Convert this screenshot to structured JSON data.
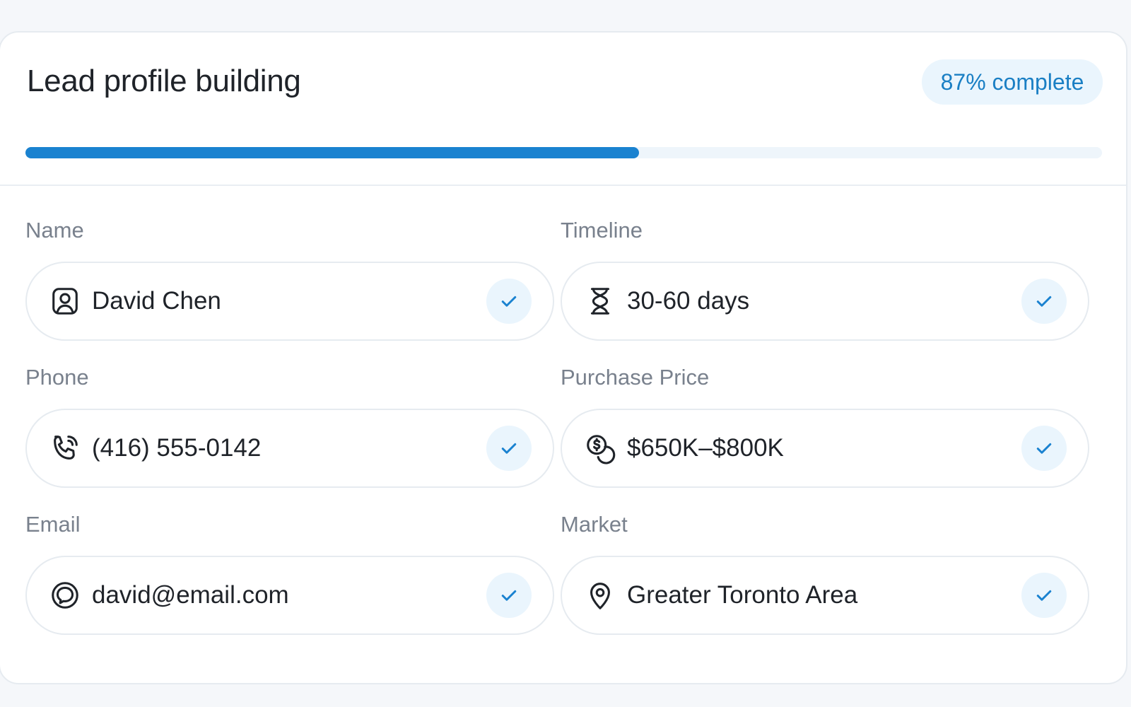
{
  "card": {
    "title": "Lead profile building",
    "badge": "87% complete",
    "progress": 0.57
  },
  "fields": {
    "name": {
      "label": "Name",
      "value": "David Chen",
      "icon": "user-icon"
    },
    "timeline": {
      "label": "Timeline",
      "value": "30-60 days",
      "icon": "hourglass-icon"
    },
    "phone": {
      "label": "Phone",
      "value": "(416) 555-0142",
      "icon": "phone-icon"
    },
    "purchase_price": {
      "label": "Purchase Price",
      "value": "$650K–$800K",
      "icon": "coins-icon"
    },
    "email": {
      "label": "Email",
      "value": "david@email.com",
      "icon": "email-icon"
    },
    "market": {
      "label": "Market",
      "value": "Greater Toronto Area",
      "icon": "map-pin-icon"
    }
  },
  "colors": {
    "accent": "#1a82d0",
    "badge_bg": "#eaf5fd",
    "check": "#1a82d0"
  }
}
